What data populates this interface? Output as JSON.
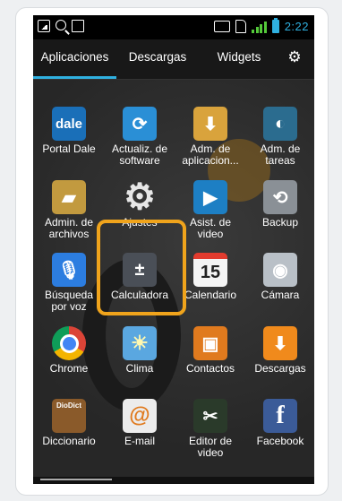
{
  "status_bar": {
    "time": "2:22",
    "left_icons": [
      "gallery-icon",
      "search-icon",
      "shopping-bag-icon"
    ],
    "right_icons": [
      "nfc-icon",
      "sim-icon",
      "signal-icon",
      "battery-icon"
    ]
  },
  "tabs": [
    {
      "label": "Aplicaciones",
      "active": true
    },
    {
      "label": "Descargas",
      "active": false
    },
    {
      "label": "Widgets",
      "active": false
    }
  ],
  "settings_icon": "gear-icon",
  "apps": [
    {
      "line1": "Portal Dale",
      "line2": "",
      "icon": "dale-logo",
      "color": "#1a6fb8",
      "glyph": "dale"
    },
    {
      "line1": "Actualiz. de",
      "line2": "software",
      "icon": "update-icon",
      "color": "#2a8fd6",
      "glyph": "⟳"
    },
    {
      "line1": "Adm. de",
      "line2": "aplicacion...",
      "icon": "app-manager-icon",
      "color": "#d9a33c",
      "glyph": "⬇"
    },
    {
      "line1": "Adm. de",
      "line2": "tareas",
      "icon": "task-manager-icon",
      "color": "#2b6c8f",
      "glyph": "◐"
    },
    {
      "line1": "Admin. de",
      "line2": "archivos",
      "icon": "folder-icon",
      "color": "#c29a3f",
      "glyph": "▰"
    },
    {
      "line1": "Ajustes",
      "line2": "",
      "icon": "settings-gear-icon",
      "color": "transparent",
      "glyph": "⚙"
    },
    {
      "line1": "Asist. de",
      "line2": "video",
      "icon": "video-assist-icon",
      "color": "#1d7fc4",
      "glyph": "▶"
    },
    {
      "line1": "Backup",
      "line2": "",
      "icon": "backup-icon",
      "color": "#8a9096",
      "glyph": "⟲"
    },
    {
      "line1": "Búsqueda",
      "line2": "por voz",
      "icon": "microphone-icon",
      "color": "#2c7de0",
      "glyph": "🎙"
    },
    {
      "line1": "Calculadora",
      "line2": "",
      "icon": "calculator-icon",
      "color": "#4a4f57",
      "glyph": "±"
    },
    {
      "line1": "Calendario",
      "line2": "",
      "icon": "calendar-icon",
      "color": "#f4f4f4",
      "glyph": "15"
    },
    {
      "line1": "Cámara",
      "line2": "",
      "icon": "camera-icon",
      "color": "#b9c0c7",
      "glyph": "◉"
    },
    {
      "line1": "Chrome",
      "line2": "",
      "icon": "chrome-icon",
      "color": "transparent",
      "glyph": "◎"
    },
    {
      "line1": "Clima",
      "line2": "",
      "icon": "weather-icon",
      "color": "#5aa7e0",
      "glyph": "☀"
    },
    {
      "line1": "Contactos",
      "line2": "",
      "icon": "contacts-icon",
      "color": "#e07a1e",
      "glyph": "▣"
    },
    {
      "line1": "Descargas",
      "line2": "",
      "icon": "downloads-icon",
      "color": "#f08a1c",
      "glyph": "⬇"
    },
    {
      "line1": "Diccionario",
      "line2": "",
      "icon": "dictionary-icon",
      "color": "#8a5a2a",
      "glyph": "DioDict"
    },
    {
      "line1": "E-mail",
      "line2": "",
      "icon": "email-icon",
      "color": "#ececec",
      "glyph": "@"
    },
    {
      "line1": "Editor de",
      "line2": "video",
      "icon": "video-editor-icon",
      "color": "#2a3a2a",
      "glyph": "✂"
    },
    {
      "line1": "Facebook",
      "line2": "",
      "icon": "facebook-icon",
      "color": "#3b5b98",
      "glyph": "f"
    }
  ]
}
